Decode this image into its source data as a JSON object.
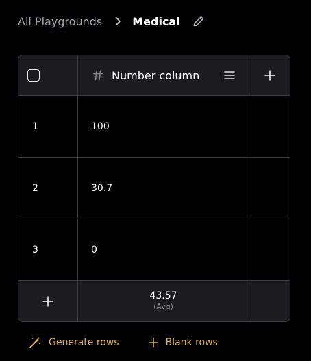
{
  "breadcrumb": {
    "parent": "All Playgrounds",
    "current": "Medical"
  },
  "table": {
    "column": {
      "name": "Number column",
      "type_icon": "hash-icon"
    },
    "rows": [
      {
        "index": "1",
        "value": "100"
      },
      {
        "index": "2",
        "value": "30.7"
      },
      {
        "index": "3",
        "value": "0"
      }
    ],
    "aggregate": {
      "value": "43.57",
      "label": "(Avg)"
    }
  },
  "actions": {
    "generate_rows": "Generate rows",
    "blank_rows": "Blank rows"
  },
  "colors": {
    "background": "#000000",
    "surface": "#1c1c1f",
    "border": "#3c3c40",
    "accent": "#e2b04a",
    "muted_text": "#a1a1a6"
  }
}
